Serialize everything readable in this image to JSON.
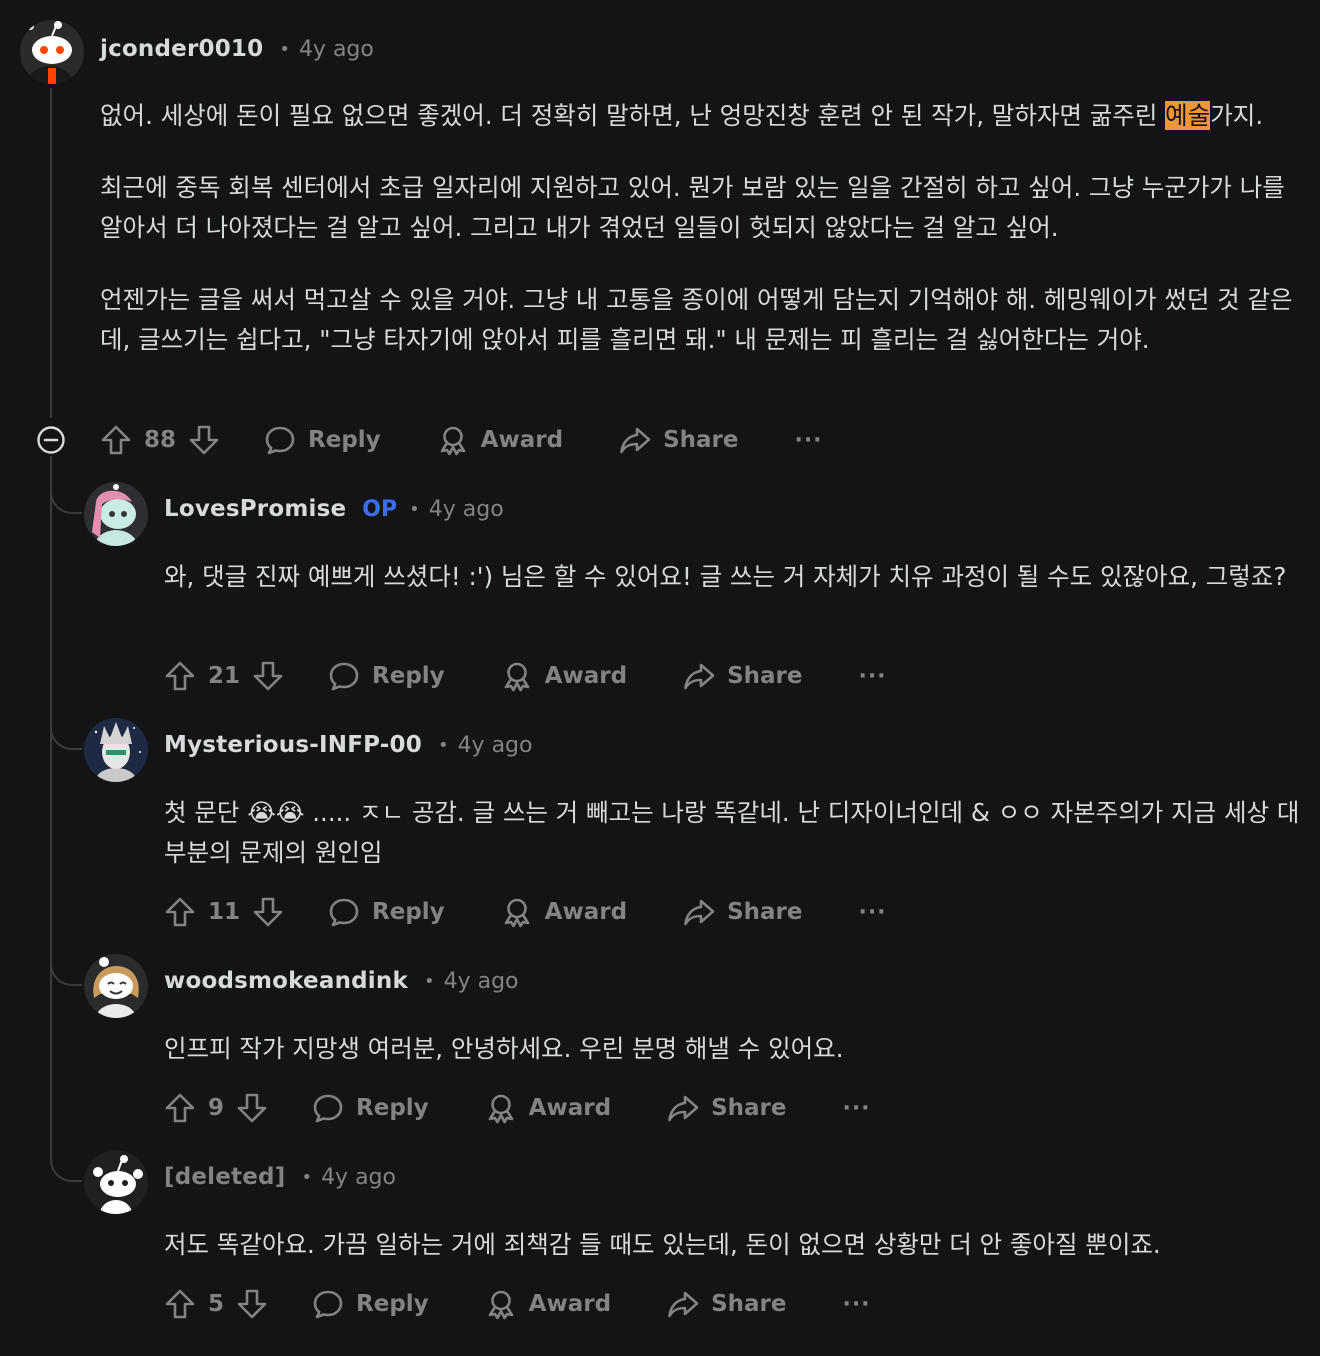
{
  "comment": {
    "username": "jconder0010",
    "time": "4y ago",
    "paragraphs": [
      {
        "before": "없어. 세상에 돈이 필요 없으면 좋겠어. 더 정확히 말하면, 난 엉망진창 훈련 안 된 작가, 말하자면 굶주린 ",
        "highlight": "예술",
        "after": "가지."
      },
      {
        "before": "최근에 중독 회복 센터에서 초급 일자리에 지원하고 있어. 뭔가 보람 있는 일을 간절히 하고 싶어. 그냥 누군가가 나를 알아서 더 나아졌다는 걸 알고 싶어. 그리고 내가 겪었던 일들이 헛되지 않았다는 걸 알고 싶어."
      },
      {
        "before": "언젠가는 글을 써서 먹고살 수 있을 거야. 그냥 내 고통을 종이에 어떻게 담는지 기억해야 해. 헤밍웨이가 썼던 것 같은데, 글쓰기는 쉽다고, \"그냥 타자기에 앉아서 피를 흘리면 돼.\" 내 문제는 피 흘리는 걸 싫어한다는 거야."
      }
    ],
    "votes": "88"
  },
  "actions": {
    "reply": "Reply",
    "award": "Award",
    "share": "Share",
    "more": "···"
  },
  "replies": [
    {
      "username": "LovesPromise",
      "op": "OP",
      "time": "4y ago",
      "text": "와, 댓글 진짜 예쁘게 쓰셨다! :') 님은 할 수 있어요! 글 쓰는 거 자체가 치유 과정이 될 수도 있잖아요, 그렇죠?",
      "votes": "21"
    },
    {
      "username": "Mysterious-INFP-00",
      "time": "4y ago",
      "text": "첫 문단 😭😭 ..... ㅈㄴ 공감. 글 쓰는 거 빼고는 나랑 똑같네. 난 디자이너인데 & ㅇㅇ 자본주의가 지금 세상 대부분의 문제의 원인임",
      "votes": "11"
    },
    {
      "username": "woodsmokeandink",
      "time": "4y ago",
      "text": "인프피 작가 지망생 여러분, 안녕하세요. 우린 분명 해낼 수 있어요.",
      "votes": "9"
    },
    {
      "username": "[deleted]",
      "time": "4y ago",
      "text": "저도 똑같아요. 가끔 일하는 거에 죄책감 들 때도 있는데, 돈이 없으면 상황만 더 안 좋아질 뿐이죠.",
      "votes": "5"
    }
  ],
  "colors": {
    "background": "#141416",
    "text": "#d7dadc",
    "meta": "#818384",
    "op": "#3b6ef5",
    "highlight": "#f0953a"
  }
}
